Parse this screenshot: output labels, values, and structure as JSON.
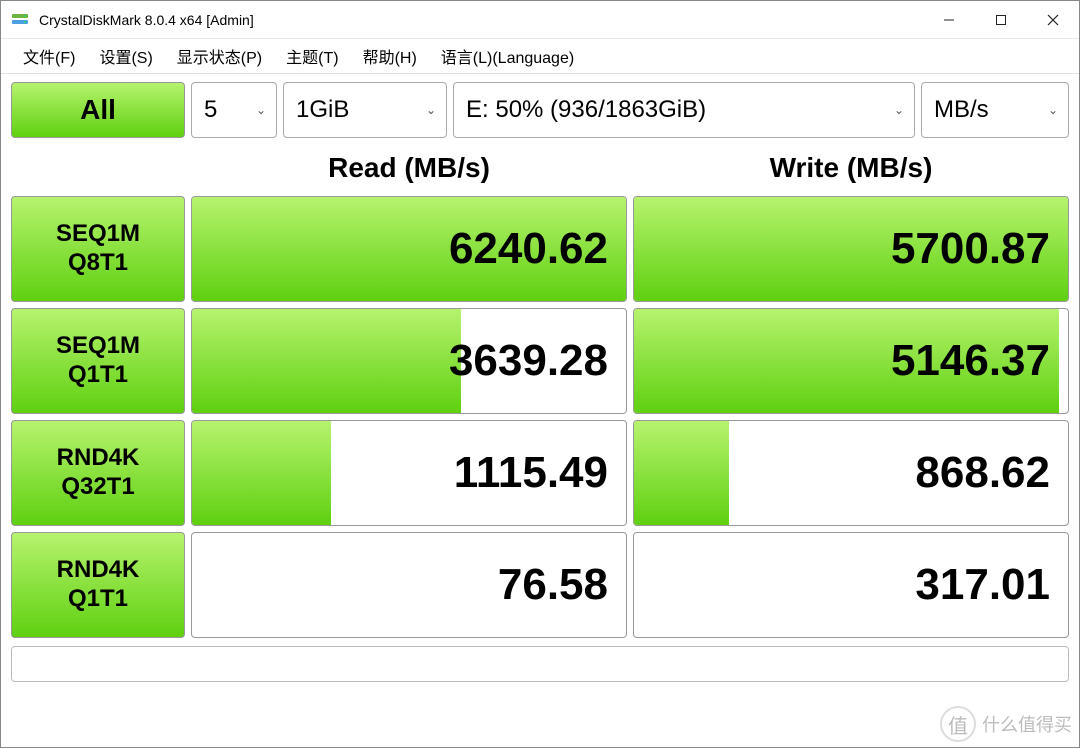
{
  "window": {
    "title": "CrystalDiskMark 8.0.4 x64 [Admin]"
  },
  "menu": {
    "file": "文件(F)",
    "settings": "设置(S)",
    "display": "显示状态(P)",
    "theme": "主题(T)",
    "help": "帮助(H)",
    "language": "语言(L)(Language)"
  },
  "controls": {
    "all_label": "All",
    "count": "5",
    "size": "1GiB",
    "drive": "E: 50% (936/1863GiB)",
    "unit": "MB/s"
  },
  "headers": {
    "read": "Read (MB/s)",
    "write": "Write (MB/s)"
  },
  "rows": [
    {
      "label1": "SEQ1M",
      "label2": "Q8T1",
      "read": "6240.62",
      "read_fill": 100,
      "write": "5700.87",
      "write_fill": 100
    },
    {
      "label1": "SEQ1M",
      "label2": "Q1T1",
      "read": "3639.28",
      "read_fill": 62,
      "write": "5146.37",
      "write_fill": 98
    },
    {
      "label1": "RND4K",
      "label2": "Q32T1",
      "read": "1115.49",
      "read_fill": 32,
      "write": "868.62",
      "write_fill": 22
    },
    {
      "label1": "RND4K",
      "label2": "Q1T1",
      "read": "76.58",
      "read_fill": 0,
      "write": "317.01",
      "write_fill": 0
    }
  ],
  "watermark": "什么值得买"
}
